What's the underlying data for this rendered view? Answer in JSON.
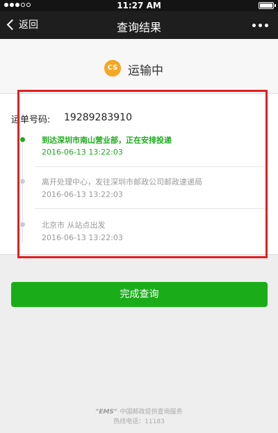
{
  "status_bar": {
    "time": "11:27 AM",
    "signal": "signal-dots-icon",
    "battery": "battery-icon"
  },
  "nav": {
    "back_label": "返回",
    "title": "查询结果",
    "more_icon": "more-dots-icon"
  },
  "shipment": {
    "status": "运输中",
    "status_icon_text": "CS",
    "tracking_label": "运单号码:",
    "tracking_number": "19289283910"
  },
  "events": [
    {
      "description": "到达深圳市南山营业部，正在安排投递",
      "time": "2016-06-13  13:22:03",
      "active": true
    },
    {
      "description": "离开处理中心，发往深圳市邮政公司邮政速递局",
      "time": "2016-06-13  13:22:03",
      "active": false
    },
    {
      "description": "北京市 从站点出发",
      "time": "2016-06-13  13:22:03",
      "active": false
    }
  ],
  "actions": {
    "done_label": "完成查询"
  },
  "footer": {
    "logo": "\"EMS\"",
    "provider": "中国邮政提供查询服务",
    "hotline": "热线电话：11183"
  },
  "colors": {
    "accent_green": "#1aad19",
    "highlight_red": "#e02020",
    "status_icon": "#f5a623"
  }
}
